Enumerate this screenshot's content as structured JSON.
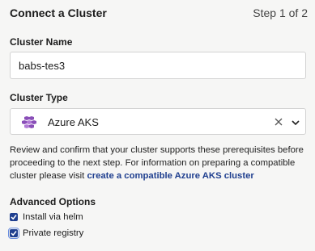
{
  "header": {
    "title": "Connect a Cluster",
    "step": "Step 1 of 2"
  },
  "form": {
    "cluster_name_label": "Cluster Name",
    "cluster_name_value": "babs-tes3",
    "cluster_type_label": "Cluster Type",
    "cluster_type_value": "Azure AKS",
    "cluster_type_icon": "azure-aks-logo-icon"
  },
  "description": {
    "text": "Review and confirm that your cluster supports these prerequisites before proceeding to the next step. For information on preparing a compatible cluster please visit ",
    "link_text": "create a compatible Azure AKS cluster"
  },
  "advanced": {
    "heading": "Advanced Options",
    "options": [
      {
        "label": "Install via helm",
        "checked": true
      },
      {
        "label": "Private registry",
        "checked": true
      }
    ]
  },
  "colors": {
    "accent": "#1f3f8f",
    "logo": "#8a4fb8"
  }
}
